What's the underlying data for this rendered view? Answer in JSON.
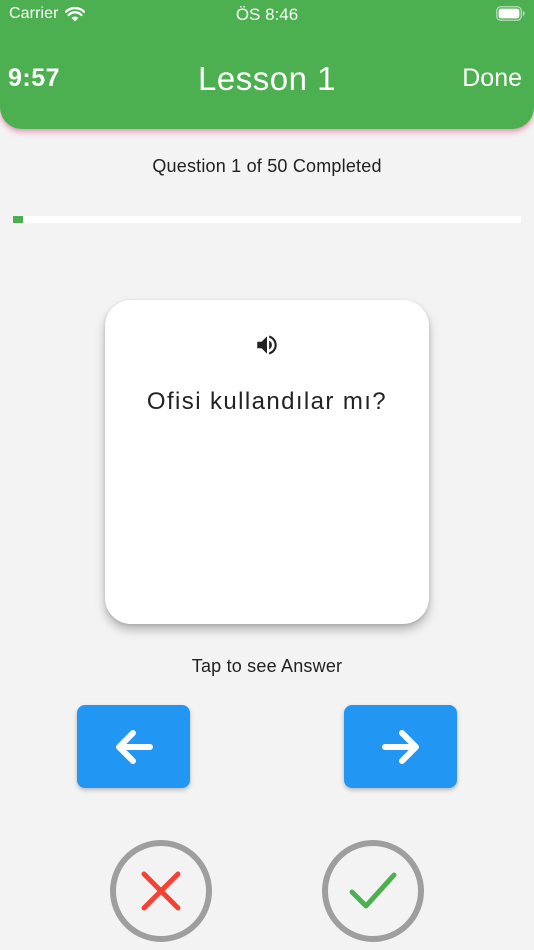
{
  "status_bar": {
    "carrier": "Carrier",
    "time": "ÖS 8:46",
    "wifi_icon": "wifi-icon",
    "battery_icon": "battery-icon"
  },
  "header": {
    "timer": "9:57",
    "title": "Lesson 1",
    "done_label": "Done",
    "color": "#4caf50"
  },
  "progress": {
    "text": "Question 1 of 50 Completed",
    "current": 1,
    "total": 50,
    "fraction": 0.02,
    "color": "#4caf50"
  },
  "card": {
    "speaker_icon": "speaker-icon",
    "question": "Ofisi kullandılar mı?"
  },
  "hint": "Tap to see Answer",
  "navigation": {
    "prev_icon": "arrow-left-icon",
    "next_icon": "arrow-right-icon",
    "color": "#2196f3"
  },
  "answer_buttons": {
    "wrong_icon": "cross-icon",
    "wrong_color": "#f44336",
    "right_icon": "check-icon",
    "right_color": "#4caf50"
  }
}
